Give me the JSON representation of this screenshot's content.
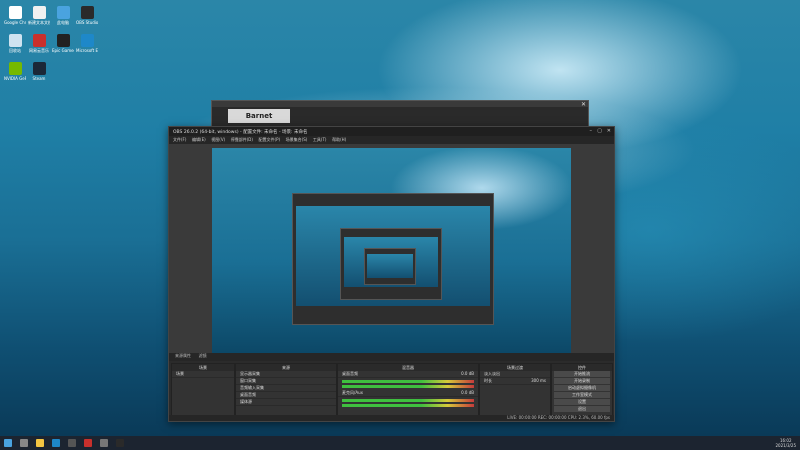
{
  "desktop": {
    "icons": [
      {
        "label": "Google Chrome",
        "color": "#ffffff"
      },
      {
        "label": "新建文本文档",
        "color": "#f0f0f0"
      },
      {
        "label": "此电脑",
        "color": "#4aa3df"
      },
      {
        "label": "OBS Studio",
        "color": "#2a2a2a"
      },
      {
        "label": "回收站",
        "color": "#cfe3f0"
      },
      {
        "label": "网易云音乐",
        "color": "#c9302c"
      },
      {
        "label": "Epic Games Launcher",
        "color": "#222222"
      },
      {
        "label": "Microsoft Edge",
        "color": "#1e88c9"
      },
      {
        "label": "NVIDIA GeForce",
        "color": "#76b900"
      },
      {
        "label": "Steam",
        "color": "#1b2838"
      }
    ],
    "notes_panel": ""
  },
  "back_window": {
    "logo_text": "Barnet"
  },
  "obs": {
    "title": "OBS 26.0.2 (64-bit, windows) - 配置文件: 未命名 - 场景: 未命名",
    "menu": [
      "文件(F)",
      "编辑(E)",
      "视图(V)",
      "停靠部件(D)",
      "配置文件(P)",
      "场景集合(S)",
      "工具(T)",
      "帮助(H)"
    ],
    "tabs_bar": [
      "来源属性",
      "滤镜"
    ],
    "docks": {
      "scenes": {
        "title": "场景",
        "items": [
          "场景"
        ]
      },
      "sources": {
        "title": "来源",
        "items": [
          "显示器采集",
          "窗口采集",
          "音频输入采集",
          "桌面音频",
          "媒体源"
        ]
      },
      "mixer": {
        "title": "混音器",
        "channels": [
          {
            "name": "桌面音频",
            "level": "0.0 dB"
          },
          {
            "name": "麦克风/Aux",
            "level": "0.0 dB"
          }
        ]
      },
      "transitions": {
        "title": "场景过渡",
        "type": "淡入淡出",
        "duration_label": "时长",
        "duration": "300 ms"
      },
      "controls": {
        "title": "控件",
        "buttons": [
          "开始推流",
          "开始录制",
          "启动虚拟摄像机",
          "工作室模式",
          "设置",
          "退出"
        ]
      }
    },
    "status": "LIVE: 00:00:00   REC: 00:00:00   CPU: 2.3%, 60.00 fps"
  },
  "taskbar": {
    "time": "16:02",
    "date": "2021/3/25"
  }
}
